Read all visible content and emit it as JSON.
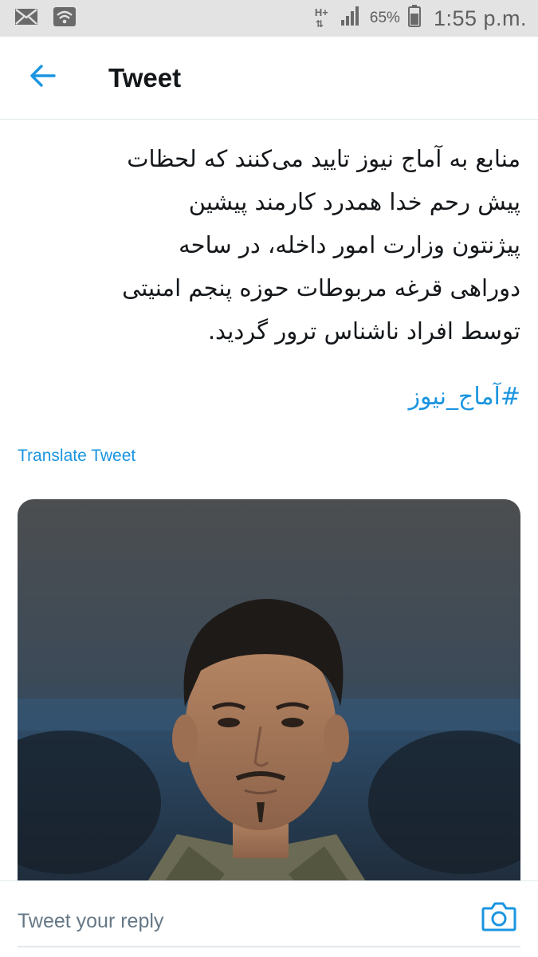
{
  "status_bar": {
    "network_type": "H+",
    "battery": "65%",
    "time": "1:55 p.m.",
    "icons": [
      "mail-icon",
      "wifi-icon",
      "signal-icon",
      "battery-icon"
    ]
  },
  "header": {
    "title": "Tweet",
    "back_icon": "arrow-left-icon"
  },
  "tweet": {
    "text": "منابع به آماج نیوز تایید می‌کنند که لحظات\nپیش رحم خدا همدرد کارمند پیشین\nپیژنتون وزارت امور داخله، در ساحه\nدوراهی قرغه مربوطات حوزه پنجم امنیتی\nتوسط افراد ناشناس ترور گردید.",
    "hashtag": "#آماج_نیوز",
    "translate_label": "Translate Tweet"
  },
  "reply": {
    "placeholder": "Tweet your reply",
    "camera_icon": "camera-icon"
  },
  "colors": {
    "accent": "#1b95e0",
    "status_bar_bg": "#e3e3e3",
    "text": "#14171a",
    "divider": "#e1e8ed"
  }
}
